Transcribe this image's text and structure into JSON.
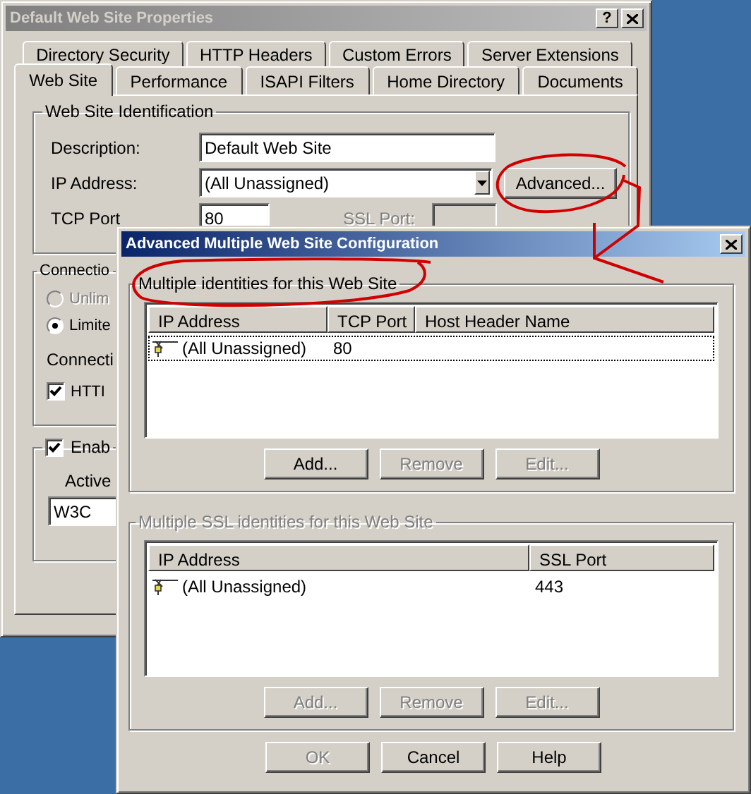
{
  "properties_window": {
    "title": "Default Web Site Properties",
    "active": false,
    "help_button": "?",
    "tab_rows": [
      [
        {
          "label": "Directory Security",
          "selected": false
        },
        {
          "label": "HTTP Headers",
          "selected": false
        },
        {
          "label": "Custom Errors",
          "selected": false
        },
        {
          "label": "Server Extensions",
          "selected": false
        }
      ],
      [
        {
          "label": "Web Site",
          "selected": true
        },
        {
          "label": "Performance",
          "selected": false
        },
        {
          "label": "ISAPI Filters",
          "selected": false
        },
        {
          "label": "Home Directory",
          "selected": false
        },
        {
          "label": "Documents",
          "selected": false
        }
      ]
    ],
    "identification": {
      "title": "Web Site Identification",
      "description": {
        "label": "Description:",
        "value": "Default Web Site"
      },
      "ip_address": {
        "label": "IP Address:",
        "value": "(All Unassigned)",
        "button": "Advanced..."
      },
      "tcp_port": {
        "label": "TCP Port",
        "value": "80"
      },
      "ssl_port": {
        "label": "SSL Port:",
        "disabled": true
      }
    },
    "connections": {
      "title": "Connectio",
      "options": [
        {
          "label": "Unlim",
          "selected": false,
          "disabled": true
        },
        {
          "label": "Limite",
          "selected": true,
          "disabled": false
        }
      ],
      "label": "Connecti",
      "checkbox": {
        "label": "HTTI",
        "checked": true
      }
    },
    "logging": {
      "label": "Enab",
      "checked": true,
      "active_label": "Active",
      "format": "W3C"
    }
  },
  "advanced_window": {
    "title": "Advanced Multiple Web Site Configuration",
    "active": true,
    "groups": [
      {
        "title": "Multiple identities for this Web Site",
        "disabled": false,
        "columns": [
          "IP Address",
          "TCP Port",
          "Host Header Name"
        ],
        "rows": [
          {
            "cells": [
              "(All Unassigned)",
              "80"
            ],
            "selected": true
          }
        ],
        "buttons": [
          {
            "label": "Add...",
            "disabled": false
          },
          {
            "label": "Remove",
            "disabled": true
          },
          {
            "label": "Edit...",
            "disabled": true
          }
        ]
      },
      {
        "title": "Multiple SSL identities for this Web Site",
        "disabled": true,
        "columns": [
          "IP Address",
          "SSL Port"
        ],
        "rows": [
          {
            "cells": [
              "(All Unassigned)",
              "443"
            ],
            "selected": false
          }
        ],
        "buttons": [
          {
            "label": "Add...",
            "disabled": true
          },
          {
            "label": "Remove",
            "disabled": true
          },
          {
            "label": "Edit...",
            "disabled": true
          }
        ]
      }
    ],
    "buttons": [
      {
        "label": "OK",
        "disabled": true
      },
      {
        "label": "Cancel",
        "disabled": false
      },
      {
        "label": "Help",
        "disabled": false
      }
    ]
  }
}
